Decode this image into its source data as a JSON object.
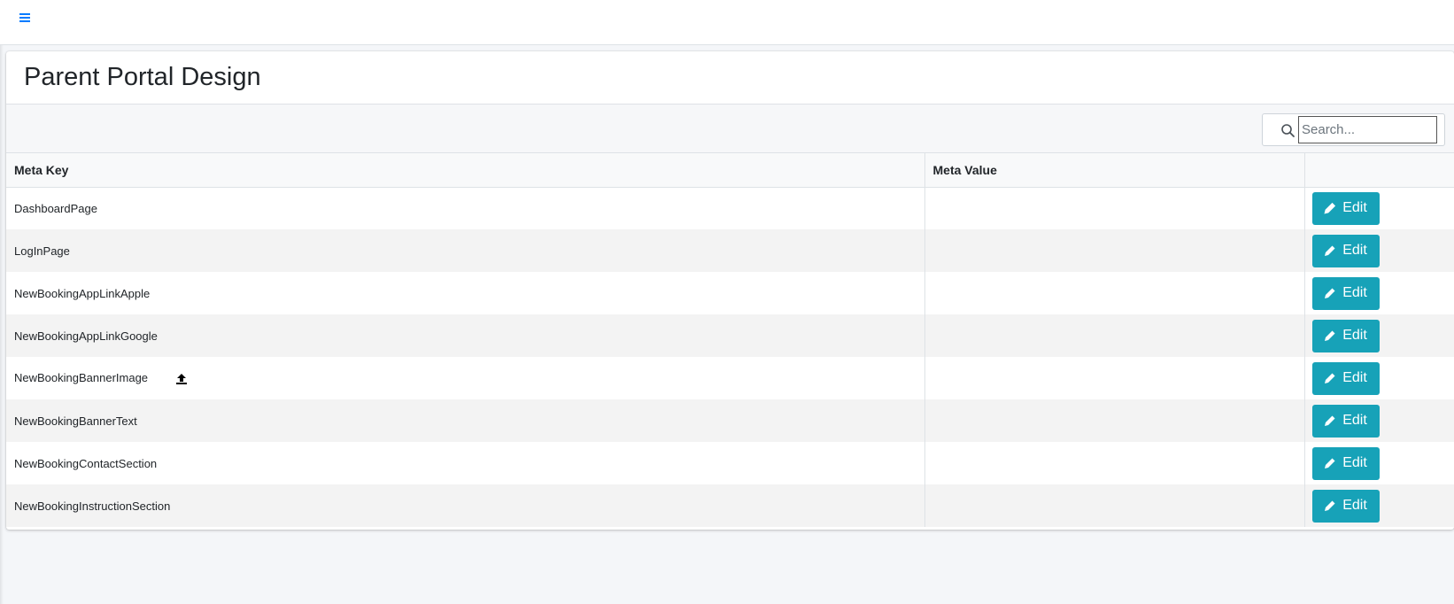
{
  "page": {
    "title": "Parent Portal Design"
  },
  "search": {
    "placeholder": "Search...",
    "value": ""
  },
  "table": {
    "headers": [
      "Meta Key",
      "Meta Value",
      ""
    ],
    "rows": [
      {
        "key": "DashboardPage",
        "value": "",
        "action": "Edit"
      },
      {
        "key": "LogInPage",
        "value": "",
        "action": "Edit"
      },
      {
        "key": "NewBookingAppLinkApple",
        "value": "",
        "action": "Edit"
      },
      {
        "key": "NewBookingAppLinkGoogle",
        "value": "",
        "action": "Edit"
      },
      {
        "key": "NewBookingBannerImage",
        "value": "",
        "action": "Edit",
        "upload_icon": "upload-icon"
      },
      {
        "key": "NewBookingBannerText",
        "value": "",
        "action": "Edit"
      },
      {
        "key": "NewBookingContactSection",
        "value": "",
        "action": "Edit"
      },
      {
        "key": "NewBookingInstructionSection",
        "value": "",
        "action": "Edit"
      }
    ]
  },
  "icons": {
    "menu": "hamburger-menu-icon",
    "search": "search-icon",
    "edit": "pencil-icon",
    "upload": "upload-icon"
  },
  "colors": {
    "accent": "#007bff",
    "edit_button": "#17a2b8",
    "background": "#f4f6f9"
  }
}
